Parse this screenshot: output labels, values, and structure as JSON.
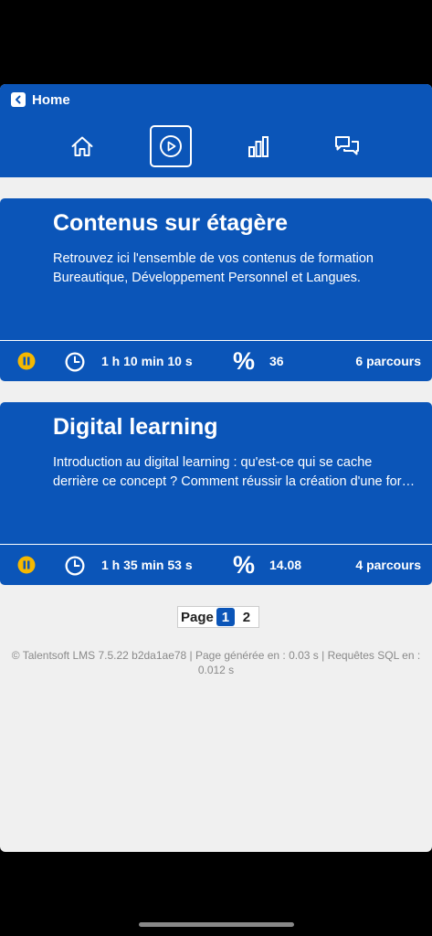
{
  "header": {
    "back_label": "Home",
    "nav": [
      {
        "name": "home",
        "icon": "home-icon",
        "active": false
      },
      {
        "name": "play",
        "icon": "play-icon",
        "active": true
      },
      {
        "name": "stats",
        "icon": "bar-chart-icon",
        "active": false
      },
      {
        "name": "chat",
        "icon": "chat-icon",
        "active": false
      }
    ]
  },
  "cards": [
    {
      "title": "Contenus sur étagère",
      "description_line1": "Retrouvez ici l'ensemble de vos contenus de formation",
      "description_line2": "Bureautique, Développement Personnel et Langues.",
      "duration": "1 h 10 min 10 s",
      "percent_symbol": "%",
      "percent": "36",
      "parcours": "6 parcours"
    },
    {
      "title": "Digital learning",
      "description_line1": "Introduction au digital learning : qu'est-ce qui se cache",
      "description_line2": "derrière ce concept ? Comment réussir la création d'une formation digitale ?",
      "duration": "1 h 35 min 53 s",
      "percent_symbol": "%",
      "percent": "14.08",
      "parcours": "4 parcours"
    }
  ],
  "pagination": {
    "label": "Page",
    "pages": [
      "1",
      "2"
    ],
    "current": "1"
  },
  "footer": {
    "text": "© Talentsoft LMS 7.5.22 b2da1ae78 | Page générée en : 0.03 s | Requêtes SQL en : 0.012 s"
  },
  "colors": {
    "primary": "#0b55b8",
    "background": "#f0f0f0",
    "pause_badge": "#f5b800"
  }
}
